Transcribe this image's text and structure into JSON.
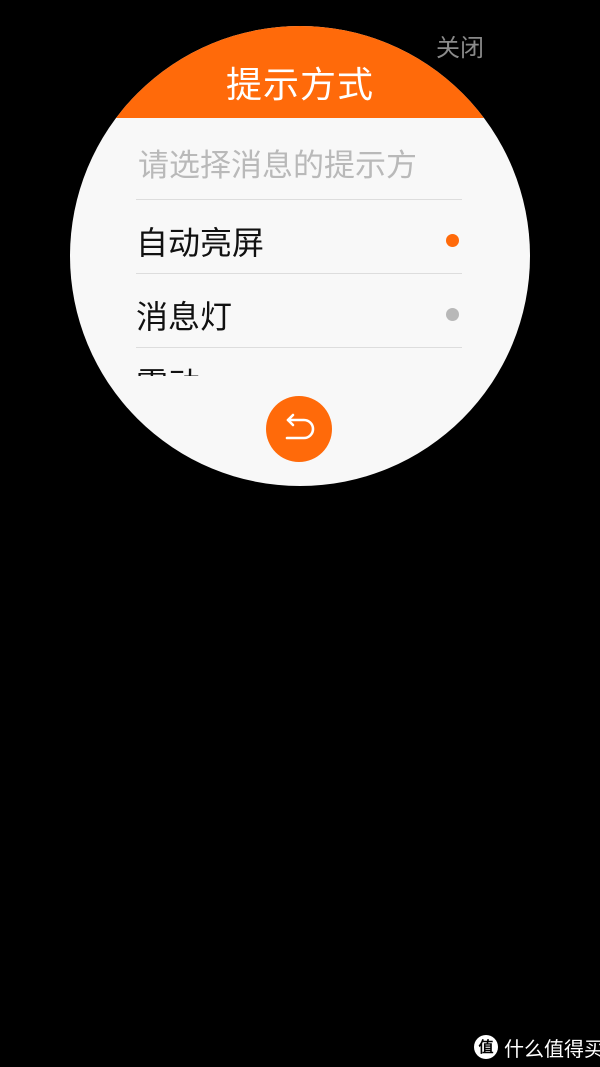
{
  "header": {
    "close_label": "关闭"
  },
  "dialog": {
    "title": "提示方式",
    "subtitle": "请选择消息的提示方",
    "options": [
      {
        "label": "自动亮屏",
        "selected": true
      },
      {
        "label": "消息灯",
        "selected": false
      }
    ],
    "partial_option_label": "震动",
    "back_icon": "back-arrow-icon"
  },
  "colors": {
    "accent": "#ff6a0a",
    "background": "#000000",
    "panel": "#f8f8f8",
    "unselected_dot": "#b8b8b8",
    "subtitle_text": "#b9b9b9"
  },
  "watermark": {
    "logo_char": "值",
    "text": "什么值得买"
  }
}
